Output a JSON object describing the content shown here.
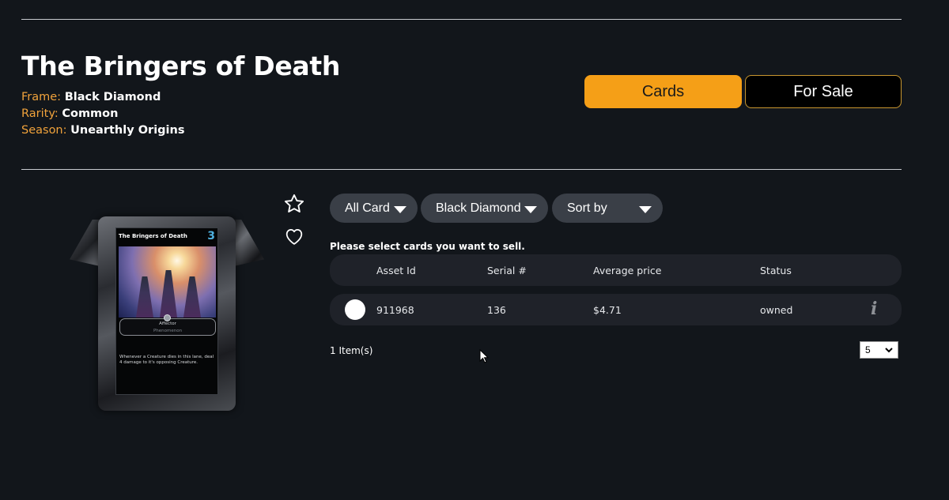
{
  "header": {
    "title": "The Bringers of Death",
    "frame_label": "Frame:",
    "frame_value": "Black Diamond",
    "rarity_label": "Rarity:",
    "rarity_value": "Common",
    "season_label": "Season:",
    "season_value": "Unearthly Origins"
  },
  "tabs": {
    "cards_label": "Cards",
    "for_sale_label": "For Sale",
    "active": "Cards"
  },
  "card": {
    "name": "The Bringers of Death",
    "cost": "3",
    "type_line": "Affector",
    "subtype_line": "Phenomenon",
    "text": "Whenever a Creature dies in this lane, deal 4 damage to it's opposing Creature."
  },
  "actions": {
    "favorite_icon": "star-icon",
    "like_icon": "heart-icon"
  },
  "filters": {
    "card_filter": "All Card",
    "frame_filter": "Black Diamond",
    "sort": "Sort by"
  },
  "hint": "Please select cards you want to sell.",
  "table": {
    "columns": {
      "asset_id": "Asset Id",
      "serial": "Serial #",
      "avg_price": "Average price",
      "status": "Status"
    },
    "rows": [
      {
        "asset_id": "911968",
        "serial": "136",
        "avg_price": "$4.71",
        "status": "owned"
      }
    ]
  },
  "footer": {
    "item_count": "1 Item(s)",
    "page_size": "5"
  },
  "colors": {
    "background": "#12161b",
    "accent": "#f59f17",
    "label": "#f0a23b",
    "row_bg": "#1f2229",
    "pill_bg": "#3a3f47"
  }
}
